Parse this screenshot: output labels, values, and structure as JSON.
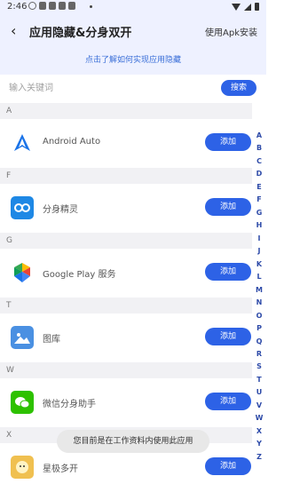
{
  "status_bar": {
    "time": "2:46"
  },
  "header": {
    "back_glyph": "‹",
    "title": "应用隐藏&分身双开",
    "apk_link": "使用Apk安装",
    "howto_link": "点击了解如何实现应用隐藏"
  },
  "search": {
    "placeholder": "输入关键词",
    "button_label": "搜索"
  },
  "sections": [
    {
      "letter": "A",
      "apps": [
        {
          "name": "Android Auto",
          "icon": "android-auto-icon",
          "action": "添加"
        }
      ]
    },
    {
      "letter": "F",
      "apps": [
        {
          "name": "分身精灵",
          "icon": "clone-sprite-icon",
          "action": "添加"
        }
      ]
    },
    {
      "letter": "G",
      "apps": [
        {
          "name": "Google Play 服务",
          "icon": "google-play-services-icon",
          "action": "添加"
        }
      ]
    },
    {
      "letter": "T",
      "apps": [
        {
          "name": "图库",
          "icon": "gallery-icon",
          "action": "添加"
        }
      ]
    },
    {
      "letter": "W",
      "apps": [
        {
          "name": "微信分身助手",
          "icon": "wechat-clone-icon",
          "action": "添加"
        }
      ]
    },
    {
      "letter": "X",
      "apps": [
        {
          "name": "星极多开",
          "icon": "xingji-multi-icon",
          "action": "添加"
        }
      ]
    }
  ],
  "alphabet": [
    "A",
    "B",
    "C",
    "D",
    "E",
    "F",
    "G",
    "H",
    "I",
    "J",
    "K",
    "L",
    "M",
    "N",
    "O",
    "P",
    "Q",
    "R",
    "S",
    "T",
    "U",
    "V",
    "W",
    "X",
    "Y",
    "Z"
  ],
  "toast": "您目前是在工作资料内使用此应用",
  "colors": {
    "accent": "#2d62e6",
    "header_bg": "#eef1ff",
    "section_bg": "#f1f1f4"
  }
}
